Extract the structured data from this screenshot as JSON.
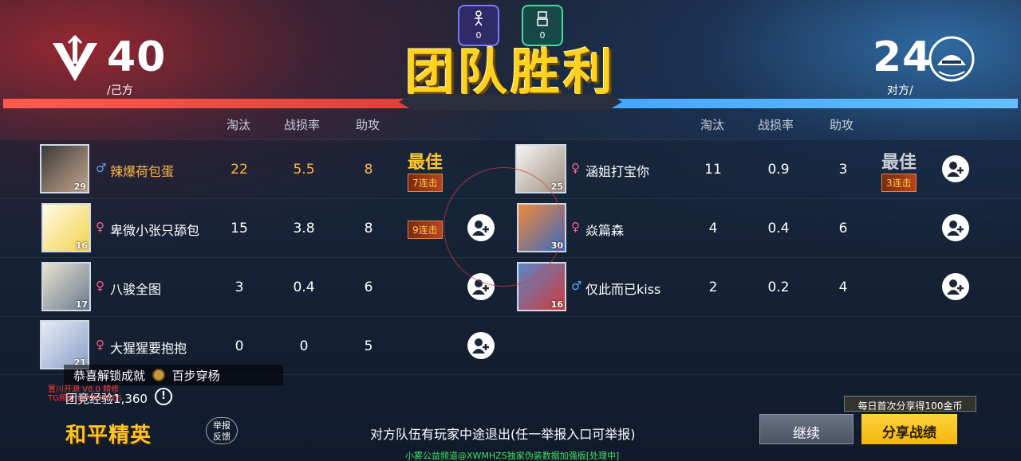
{
  "my_team": {
    "score": "40",
    "label": "/己方"
  },
  "enemy_team": {
    "score": "24",
    "label": "对方/"
  },
  "result_title": "团队胜利",
  "mini_counters": [
    {
      "value": "0"
    },
    {
      "value": "0"
    }
  ],
  "columns": {
    "kills": "淘汰",
    "damage_rate": "战损率",
    "assists": "助攻"
  },
  "left_players": [
    {
      "name": "辣爆荷包蛋",
      "gender": "♂",
      "level": "29",
      "kills": "22",
      "rate": "5.5",
      "assists": "8",
      "best": "最佳",
      "streak": "7连击"
    },
    {
      "name": "卑微小张只舔包",
      "gender": "♀",
      "level": "16",
      "kills": "15",
      "rate": "3.8",
      "assists": "8",
      "streak": "9连击"
    },
    {
      "name": "八骏全图",
      "gender": "♀",
      "level": "17",
      "kills": "3",
      "rate": "0.4",
      "assists": "6"
    },
    {
      "name": "大猩猩要抱抱",
      "gender": "♀",
      "level": "21",
      "kills": "0",
      "rate": "0",
      "assists": "5"
    }
  ],
  "right_players": [
    {
      "name": "涵姐打宝你",
      "gender": "♀",
      "level": "25",
      "kills": "11",
      "rate": "0.9",
      "assists": "3",
      "best": "最佳",
      "streak": "3连击"
    },
    {
      "name": "焱篇森",
      "gender": "♀",
      "level": "30",
      "kills": "4",
      "rate": "0.4",
      "assists": "6"
    },
    {
      "name": "仅此而已kiss",
      "gender": "♂",
      "level": "16",
      "kills": "2",
      "rate": "0.2",
      "assists": "4"
    }
  ],
  "achievement": {
    "prefix": "恭喜解锁成就",
    "name": "百步穿杨"
  },
  "watermark": {
    "line1": "置川开源 V8.0 精修",
    "line2": "TG频道:@XWMHZS"
  },
  "exp": {
    "label": "团竞经验",
    "value": "1,360"
  },
  "logo": "和平精英",
  "report_btn": {
    "line1": "举报",
    "line2": "反馈"
  },
  "notice": "对方队伍有玩家中途退出(任一举报入口可举报)",
  "daily_tip": "每日首次分享得100金币",
  "continue_label": "继续",
  "share_label": "分享战绩",
  "footer_text": "小雾公益频道@XWMHZS独家伪装数据加强版[处理中]",
  "colors": {
    "highlight": "#ffb545",
    "share_button": "#f7c21f",
    "red_team": "#e0443a",
    "blue_team": "#4aa8ff"
  }
}
